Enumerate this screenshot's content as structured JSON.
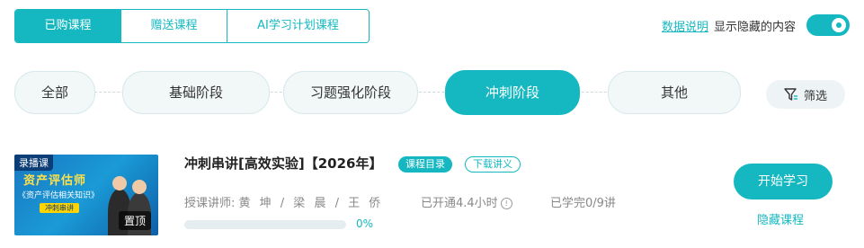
{
  "top_tabs": [
    {
      "label": "已购课程",
      "active": true
    },
    {
      "label": "赠送课程",
      "active": false
    },
    {
      "label": "AI学习计划课程",
      "active": false
    }
  ],
  "header_right": {
    "data_link": "数据说明",
    "show_hidden_label": "显示隐藏的内容",
    "toggle_on": true
  },
  "stages": [
    {
      "label": "全部",
      "active": false
    },
    {
      "label": "基础阶段",
      "active": false
    },
    {
      "label": "习题强化阶段",
      "active": false
    },
    {
      "label": "冲刺阶段",
      "active": true
    },
    {
      "label": "其他",
      "active": false
    }
  ],
  "filter": {
    "label": "筛选",
    "icon": "filter-icon"
  },
  "course": {
    "thumb": {
      "tag": "录播课",
      "title": "资产评估师",
      "subtitle": "《资产评估相关知识》",
      "badge": "冲刺串讲",
      "pin": "置顶"
    },
    "title": "冲刺串讲[高效实验]【2026年】",
    "badge_catalog": "课程目录",
    "badge_download": "下载讲义",
    "teachers_label": "授课讲师:",
    "teachers": "黄 坤 / 梁 晨 / 王 侨",
    "opened": "已开通4.4小时",
    "completed": "已学完0/9讲",
    "progress_percent": 0,
    "progress_text": "0%",
    "start_button": "开始学习",
    "hide_link": "隐藏课程"
  },
  "colors": {
    "accent": "#15b8c1"
  }
}
